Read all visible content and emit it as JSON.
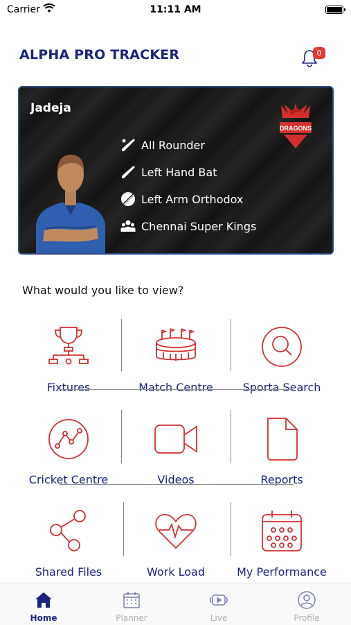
{
  "status_bar": {
    "carrier": "Carrier",
    "time": "11:11 AM"
  },
  "header": {
    "title": "ALPHA PRO TRACKER",
    "notification_count": "0"
  },
  "player_card": {
    "name": "Jadeja",
    "role": "All Rounder",
    "batting": "Left Hand Bat",
    "bowling": "Left Arm Orthodox",
    "team": "Chennai Super Kings",
    "logo_text": "DRAGONS"
  },
  "prompt": "What would you like to view?",
  "menu": {
    "fixtures": "Fixtures",
    "match_centre": "Match Centre",
    "sporta_search": "Sporta Search",
    "cricket_centre": "Cricket Centre",
    "videos": "Videos",
    "reports": "Reports",
    "shared_files": "Shared Files",
    "work_load": "Work Load",
    "my_performance": "My Performance"
  },
  "tabs": {
    "home": "Home",
    "planner": "Planner",
    "live": "Live",
    "profile": "Profile"
  },
  "colors": {
    "accent": "#1a237e",
    "icon_red": "#d32f2f",
    "badge": "#e53935"
  }
}
